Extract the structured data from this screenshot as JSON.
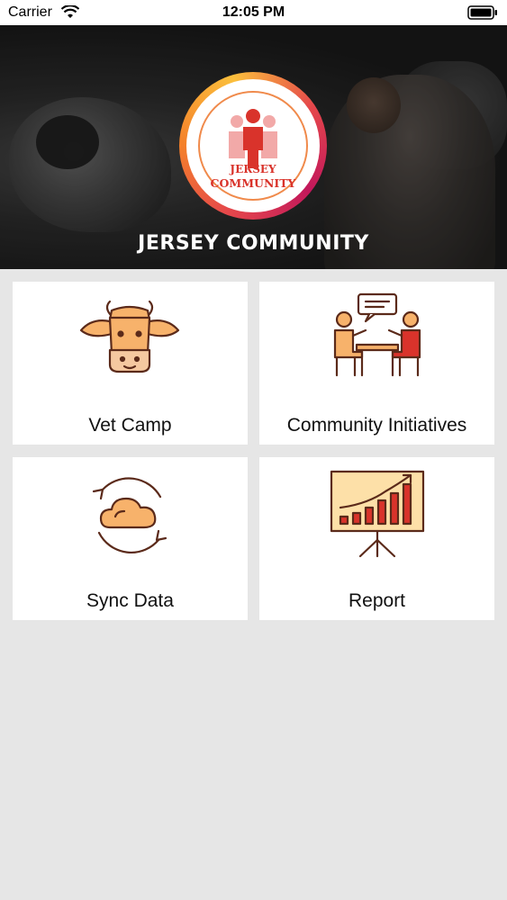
{
  "status_bar": {
    "carrier": "Carrier",
    "time": "12:05 PM"
  },
  "header": {
    "logo_text_top": "JERSEY",
    "logo_text_bottom": "COMMUNITY",
    "title": "JERSEY COMMUNITY"
  },
  "menu": {
    "vet_camp": {
      "label": "Vet Camp",
      "icon": "cow-icon"
    },
    "community_initiatives": {
      "label": "Community Initiatives",
      "icon": "meeting-icon"
    },
    "sync_data": {
      "label": "Sync Data",
      "icon": "cloud-sync-icon"
    },
    "report": {
      "label": "Report",
      "icon": "chart-board-icon"
    }
  },
  "colors": {
    "icon_fill": "#f7b26b",
    "icon_stroke": "#5b2a1a",
    "accent_red": "#d9332b",
    "background": "#e6e6e6"
  }
}
